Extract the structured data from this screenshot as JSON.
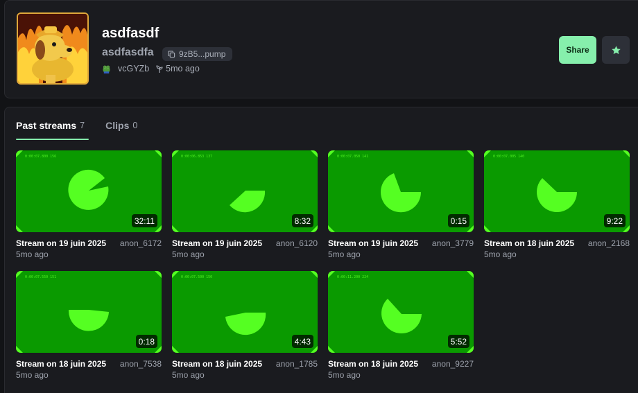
{
  "coin": {
    "name": "asdfasdf",
    "ticker": "asdfasdfa",
    "address_short": "9zB5...pump",
    "creator": "vcGYZb",
    "age": "5mo ago"
  },
  "actions": {
    "share_label": "Share"
  },
  "icons": {
    "avatar": "this-is-fine-dog-image",
    "address": "copy-icon",
    "creator": "frog-avatar-icon",
    "age": "sprout-icon",
    "favorite": "star-icon"
  },
  "colors": {
    "accent": "#86efac",
    "thumbnail_bg": "#0a9a00",
    "thumbnail_shape": "#55ff22"
  },
  "tabs": [
    {
      "label": "Past streams",
      "count": "7",
      "active": true
    },
    {
      "label": "Clips",
      "count": "0",
      "active": false
    }
  ],
  "streams": [
    {
      "title": "Stream on 19 juin 2025",
      "user": "anon_6172",
      "age": "5mo ago",
      "duration": "32:11",
      "timecode": "0:00:07.800 156"
    },
    {
      "title": "Stream on 19 juin 2025",
      "user": "anon_6120",
      "age": "5mo ago",
      "duration": "8:32",
      "timecode": "0:00:06.853 137"
    },
    {
      "title": "Stream on 19 juin 2025",
      "user": "anon_3779",
      "age": "5mo ago",
      "duration": "0:15",
      "timecode": "0:00:07.050 141"
    },
    {
      "title": "Stream on 18 juin 2025",
      "user": "anon_2168",
      "age": "5mo ago",
      "duration": "9:22",
      "timecode": "0:00:07.005 140"
    },
    {
      "title": "Stream on 18 juin 2025",
      "user": "anon_7538",
      "age": "5mo ago",
      "duration": "0:18",
      "timecode": "0:00:07.550 151"
    },
    {
      "title": "Stream on 18 juin 2025",
      "user": "anon_1785",
      "age": "5mo ago",
      "duration": "4:43",
      "timecode": "0:00:07.500 150"
    },
    {
      "title": "Stream on 18 juin 2025",
      "user": "anon_9227",
      "age": "5mo ago",
      "duration": "5:52",
      "timecode": "0:00:11.200 224"
    }
  ]
}
